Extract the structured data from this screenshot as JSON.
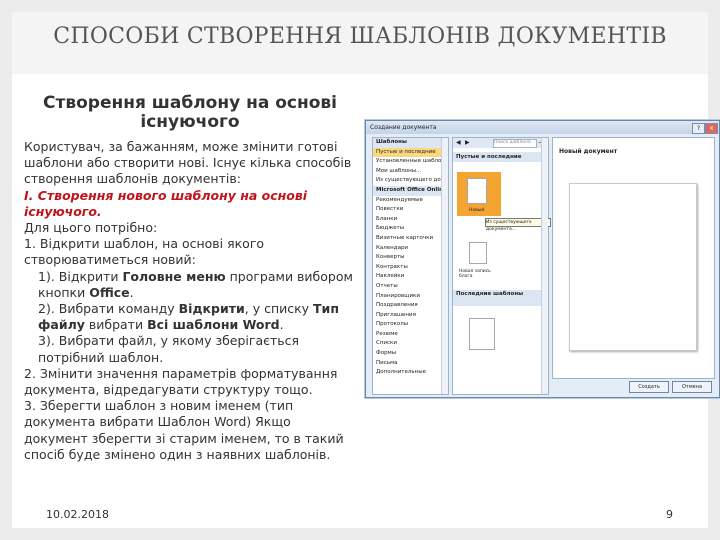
{
  "slide": {
    "title": "СПОСОБИ СТВОРЕННЯ ШАБЛОНІВ ДОКУМЕНТІВ",
    "subtitle": "Створення шаблону на основі існуючого",
    "paragraphs": [
      "Користувач, за бажанням, може змінити готові шаблони або створити нові. Існує кілька способів створення шаблонів документів:",
      "Для цього потрібно:",
      "1. Відкрити шаблон, на основі якого створюватиметься новий:"
    ],
    "red_heading": "І. Створення нового шаблону на основі існуючого.",
    "step1": {
      "pre": "1). Відкрити ",
      "bold": "Головне меню",
      "post": " програми вибором кнопки ",
      "bold2": "Office",
      "end": "."
    },
    "step2": {
      "pre": "2). Вибрати команду ",
      "bold": "Відкрити",
      "mid": ", у списку ",
      "bold2": "Тип файлу",
      "mid2": " вибрати ",
      "bold3": "Всі шаблони Word",
      "end": "."
    },
    "step3": "3). Вибрати файл, у якому зберігається потрібний шаблон.",
    "point2": "2. Змінити значення параметрів форматування документа, відредагувати структуру тощо.",
    "point3": "3. Зберегти шаблон з новим іменем (тип документа вибрати Шаблон Word) Якщо документ зберегти зі старим іменем, то в такий спосіб буде змінено один з наявних шаблонів.",
    "date": "10.02.2018",
    "page_number": "9"
  },
  "dialog": {
    "title": "Создание документа",
    "left_items": [
      {
        "label": "Шаблоны",
        "type": "hdr"
      },
      {
        "label": "Пустые и последние",
        "type": "sel"
      },
      {
        "label": "Установленные шаблоны",
        "type": ""
      },
      {
        "label": "Мои шаблоны...",
        "type": ""
      },
      {
        "label": "Из существующего документа...",
        "type": ""
      },
      {
        "label": "Microsoft Office Online",
        "type": "hdr"
      },
      {
        "label": "Рекомендуемые",
        "type": ""
      },
      {
        "label": "Повестки",
        "type": ""
      },
      {
        "label": "Бланки",
        "type": ""
      },
      {
        "label": "Бюджеты",
        "type": ""
      },
      {
        "label": "Визитные карточки",
        "type": ""
      },
      {
        "label": "Календари",
        "type": ""
      },
      {
        "label": "Конверты",
        "type": ""
      },
      {
        "label": "Контракты",
        "type": ""
      },
      {
        "label": "Наклейки",
        "type": ""
      },
      {
        "label": "Отчеты",
        "type": ""
      },
      {
        "label": "Планировщики",
        "type": ""
      },
      {
        "label": "Поздравления",
        "type": ""
      },
      {
        "label": "Приглашения",
        "type": ""
      },
      {
        "label": "Протоколы",
        "type": ""
      },
      {
        "label": "Резюме",
        "type": ""
      },
      {
        "label": "Списки",
        "type": ""
      },
      {
        "label": "Формы",
        "type": ""
      },
      {
        "label": "Письма",
        "type": ""
      },
      {
        "label": "Дополнительные",
        "type": ""
      }
    ],
    "search_placeholder": "Поиск шаблона",
    "section_blank": "Пустые и последние",
    "section_recent": "Последние шаблоны",
    "tile_new": "Новый",
    "tile_blog": "Новая запись блога",
    "tooltip": "Из существующего документа...",
    "right_title": "Новый документ",
    "btn_create": "Создать",
    "btn_cancel": "Отмена"
  }
}
